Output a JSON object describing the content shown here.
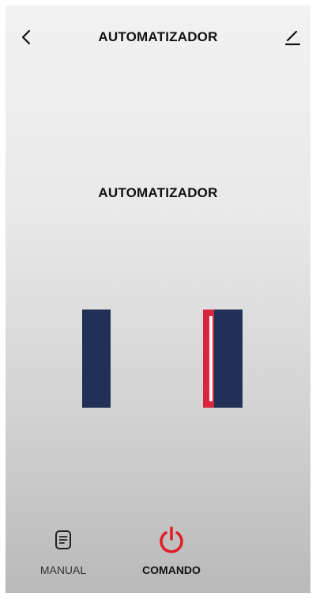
{
  "header": {
    "title": "AUTOMATIZADOR",
    "back_icon": "chevron-left-icon",
    "edit_icon": "pencil-icon"
  },
  "device": {
    "name": "AUTOMATIZADOR"
  },
  "gate": {
    "panel_color": "#213056",
    "indicator_color": "#d7263d"
  },
  "bottom_nav": {
    "items": [
      {
        "label": "MANUAL",
        "icon": "document-icon",
        "active": false
      },
      {
        "label": "COMANDO",
        "icon": "power-icon",
        "active": true,
        "icon_color": "#e01f26"
      }
    ]
  }
}
